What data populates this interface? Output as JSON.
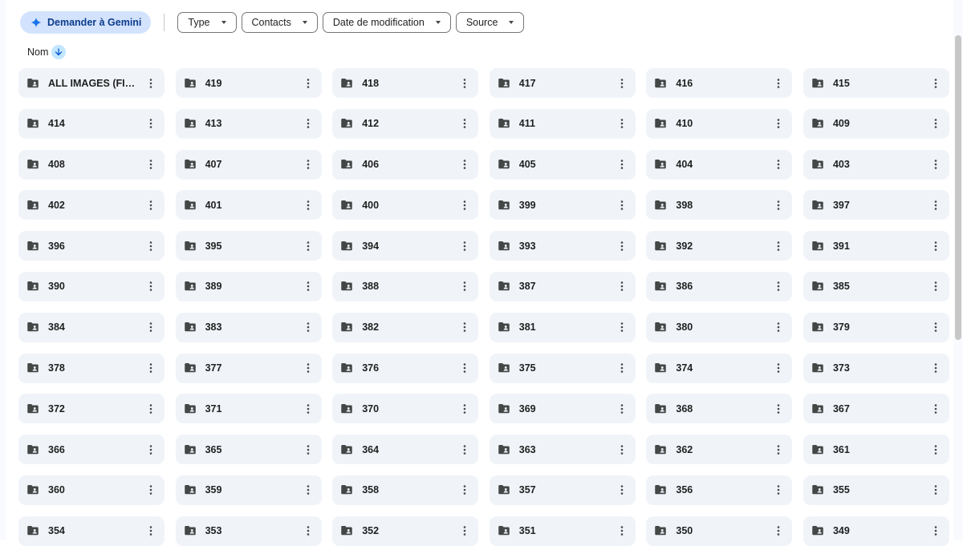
{
  "toolbar": {
    "gemini_label": "Demander à Gemini",
    "gemini_icon": "sparkle-icon",
    "filters": [
      {
        "label": "Type"
      },
      {
        "label": "Contacts"
      },
      {
        "label": "Date de modification"
      },
      {
        "label": "Source"
      }
    ]
  },
  "sort": {
    "label": "Nom",
    "direction_icon": "arrow-down-icon"
  },
  "colors": {
    "gemini_bg": "#d3e3fd",
    "tile_bg": "#f0f4f9",
    "sort_bubble": "#c2e7ff",
    "icon": "#444746"
  },
  "folders": [
    "ALL IMAGES (FIDGET...",
    "419",
    "418",
    "417",
    "416",
    "415",
    "414",
    "413",
    "412",
    "411",
    "410",
    "409",
    "408",
    "407",
    "406",
    "405",
    "404",
    "403",
    "402",
    "401",
    "400",
    "399",
    "398",
    "397",
    "396",
    "395",
    "394",
    "393",
    "392",
    "391",
    "390",
    "389",
    "388",
    "387",
    "386",
    "385",
    "384",
    "383",
    "382",
    "381",
    "380",
    "379",
    "378",
    "377",
    "376",
    "375",
    "374",
    "373",
    "372",
    "371",
    "370",
    "369",
    "368",
    "367",
    "366",
    "365",
    "364",
    "363",
    "362",
    "361",
    "360",
    "359",
    "358",
    "357",
    "356",
    "355",
    "354",
    "353",
    "352",
    "351",
    "350",
    "349"
  ]
}
